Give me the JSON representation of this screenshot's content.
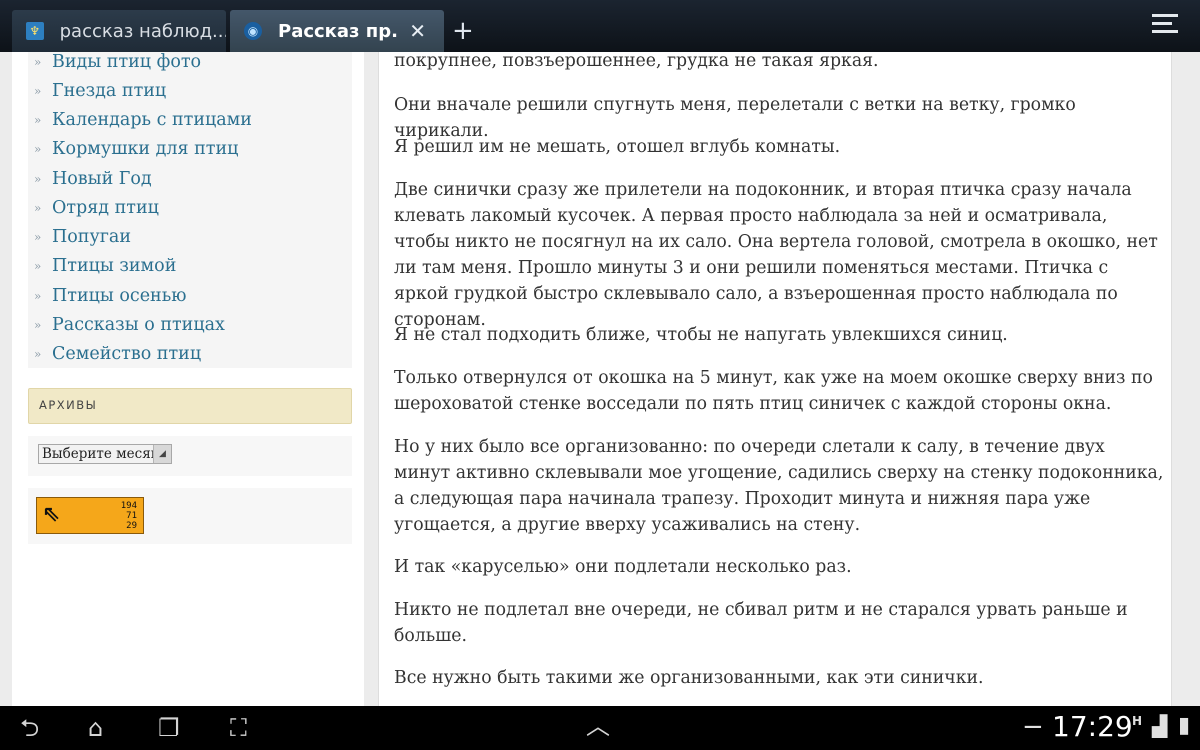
{
  "browser": {
    "tabs": [
      {
        "title": "рассказ наблюд...",
        "active": false
      },
      {
        "title": "Рассказ пр...",
        "active": true
      }
    ],
    "close_glyph": "✕",
    "new_tab_glyph": "+"
  },
  "sidebar": {
    "categories": [
      "Виды птиц фото",
      "Гнезда птиц",
      "Календарь с птицами",
      "Кормушки для птиц",
      "Новый Год",
      "Отряд птиц",
      "Попугаи",
      "Птицы зимой",
      "Птицы осенью",
      "Рассказы о птицах",
      "Семейство птиц"
    ],
    "bullet": "»",
    "archives_title": "АРХИВЫ",
    "month_select": "Выберите месяц",
    "counter": {
      "line1": "194",
      "line2": "71",
      "line3": "29"
    }
  },
  "article": {
    "paragraphs": [
      "покрупнее, повзъерошеннее, грудка не такая яркая.",
      "Они вначале решили спугнуть меня, перелетали с ветки на ветку, громко чирикали.",
      "Я решил им не мешать, отошел вглубь комнаты.",
      "Две синички сразу же прилетели на подоконник, и вторая птичка сразу начала клевать лакомый кусочек. А первая просто наблюдала за ней и осматривала, чтобы никто не посягнул на их сало. Она вертела головой, смотрела в окошко, нет ли там меня. Прошло минуты 3 и они решили поменяться местами. Птичка с яркой грудкой быстро склевывало сало, а взъерошенная просто наблюдала по сторонам.",
      "Я не стал подходить ближе, чтобы не напугать увлекшихся синиц.",
      "Только отвернулся от окошка на 5 минут, как уже на моем окошке сверху вниз по шероховатой стенке восседали по пять птиц синичек с каждой стороны окна.",
      "Но у них было все организованно: по очереди слетали к салу, в течение двух минут активно склевывали мое угощение, садились сверху на стенку подоконника, а следующая пара начинала трапезу. Проходит минута и нижняя пара уже угощается, а другие вверху усаживались на стену.",
      "И так «каруселью» они подлетали несколько раз.",
      "Никто не подлетал вне очереди, не сбивал ритм и не старался урвать раньше и больше.",
      "Все нужно быть такими же организованными, как эти синички."
    ]
  },
  "system": {
    "clock": "17:29",
    "network_label": "H",
    "minus_glyph": "−"
  }
}
